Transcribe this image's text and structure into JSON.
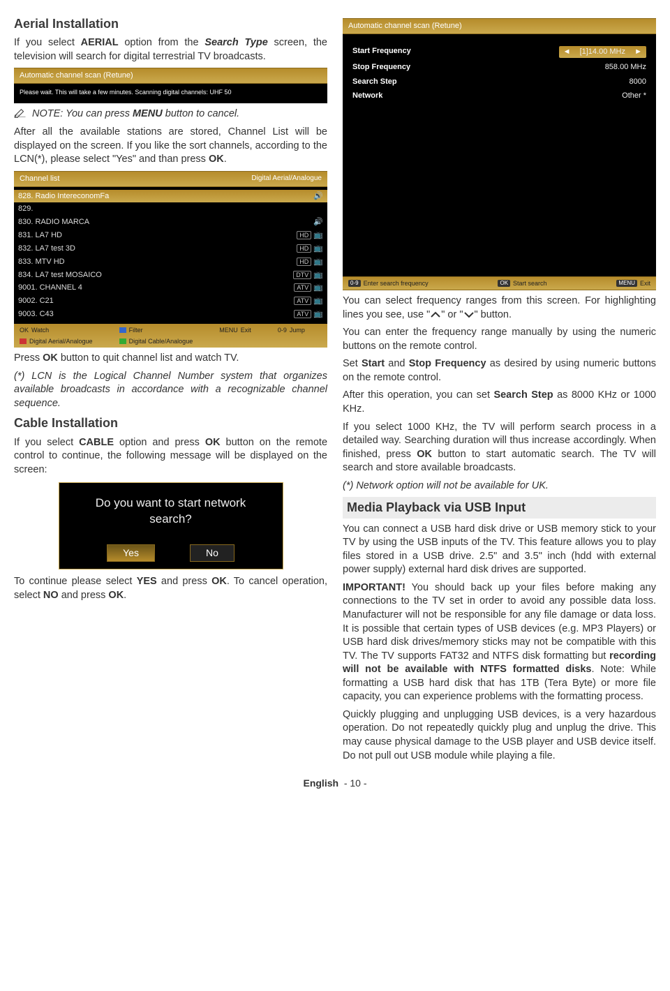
{
  "left": {
    "h_aerial": "Aerial Installation",
    "p_aerial_intro_a": "If you select ",
    "p_aerial_intro_b": "AERIAL",
    "p_aerial_intro_c": " option from the ",
    "p_aerial_intro_d": "Search Type",
    "p_aerial_intro_e": " screen, the television will search for digital terrestrial TV broadcasts.",
    "retune_shot": {
      "title": "Automatic channel scan (Retune)",
      "msg": "Please wait. This will take a few minutes. Scanning digital channels: UHF 50"
    },
    "note_a": "NOTE: You can press ",
    "note_b": "MENU",
    "note_c": " button to cancel.",
    "p_after_a": "After all the available stations are stored, Channel List will be displayed on the screen. If you like the sort channels, according to the LCN(*), please select \"Yes\" and than press ",
    "p_after_b": "OK",
    "p_after_c": ".",
    "chlist": {
      "title_l": "Channel list",
      "title_r": "Digital Aerial/Analogue",
      "rows": [
        {
          "n": "828. Radio IntereconomFa",
          "tag": ""
        },
        {
          "n": "829.",
          "tag": ""
        },
        {
          "n": "830. RADIO MARCA",
          "tag": ""
        },
        {
          "n": "831. LA7 HD",
          "tag": "HD"
        },
        {
          "n": "832. LA7 test 3D",
          "tag": "HD"
        },
        {
          "n": "833. MTV HD",
          "tag": "HD"
        },
        {
          "n": "834. LA7 test MOSAICO",
          "tag": "DTV"
        },
        {
          "n": "9001. CHANNEL 4",
          "tag": "ATV"
        },
        {
          "n": "9002. C21",
          "tag": "ATV"
        },
        {
          "n": "9003. C43",
          "tag": "ATV"
        }
      ],
      "legend": {
        "watch": "Watch",
        "filter": "Filter",
        "exit": "Exit",
        "jump": "Jump",
        "daa": "Digital Aerial/Analogue",
        "dca": "Digital Cable/Analogue"
      }
    },
    "p_pressok_a": "Press ",
    "p_pressok_b": "OK",
    "p_pressok_c": " button to quit channel list and watch TV.",
    "p_lcn": "(*) LCN is the Logical Channel Number system that organizes available broadcasts in accordance with a recognizable channel sequence.",
    "h_cable": "Cable Installation",
    "p_cable_a": "If you select ",
    "p_cable_b": "CABLE",
    "p_cable_c": " option and press ",
    "p_cable_d": "OK",
    "p_cable_e": " button on the remote control to continue, the following message will be displayed on the screen:",
    "dialog": {
      "q1": "Do you want to start network",
      "q2": "search?",
      "yes": "Yes",
      "no": "No"
    },
    "p_cont_a": "To continue please select ",
    "p_cont_b": "YES",
    "p_cont_c": " and press ",
    "p_cont_d": "OK",
    "p_cont_e": ". To cancel operation, select ",
    "p_cont_f": "NO",
    "p_cont_g": " and press ",
    "p_cont_h": "OK",
    "p_cont_i": "."
  },
  "right": {
    "scan": {
      "title": "Automatic channel scan (Retune)",
      "rows": [
        {
          "l": "Start Frequency",
          "v": "[1]14.00 MHz",
          "sel": true
        },
        {
          "l": "Stop Frequency",
          "v": "858.00 MHz"
        },
        {
          "l": "Search Step",
          "v": "8000"
        },
        {
          "l": "Network",
          "v": "Other    *"
        }
      ],
      "bb": {
        "a": "Enter search frequency",
        "b": "Start search",
        "c": "Exit"
      }
    },
    "p_freq_a": "You can select frequency ranges from this screen. For highlighting lines you see, use \"",
    "p_freq_b": "\" or \"",
    "p_freq_c": "\" button.",
    "p_manual": "You can enter the frequency range manually by using the numeric buttons on the remote control.",
    "p_set_a": "Set ",
    "p_set_b": "Start",
    "p_set_c": " and ",
    "p_set_d": "Stop Frequency",
    "p_set_e": " as desired by using numeric buttons on the remote control.",
    "p_step_a": "After this operation, you can set ",
    "p_step_b": "Search Step",
    "p_step_c": " as 8000 KHz or 1000 KHz.",
    "p_1000_a": "If you select 1000 KHz, the TV will perform search process in a detailed way. Searching duration will thus increase accordingly. When finished, press ",
    "p_1000_b": "OK",
    "p_1000_c": " button to start automatic search. The TV will search and store available broadcasts.",
    "p_net": "(*) Network option will not be available for UK.",
    "h_media": "Media Playback via USB Input",
    "p_usb1": "You can connect a USB hard disk drive or USB memory stick to your TV by using the USB inputs of the TV. This feature allows you to play files stored in a USB drive. 2.5\" and 3.5\" inch (hdd with external power supply) external hard disk drives are supported.",
    "p_usb2_a": "IMPORTANT!",
    "p_usb2_b": " You should back up your files before making any connections to the TV set in order to avoid any possible data loss. Manufacturer will not be responsible for any file damage or data loss. It is possible that certain types of USB devices (e.g. MP3 Players) or USB hard disk drives/memory sticks may not be compatible with this TV. The TV supports FAT32 and NTFS disk formatting but ",
    "p_usb2_c": "recording will not be available with NTFS formatted disks",
    "p_usb2_d": ". Note: While formatting a USB hard disk that has 1TB (Tera Byte) or more file capacity, you can experience problems with the formatting process.",
    "p_usb3": "Quickly plugging and unplugging USB devices, is a very hazardous operation. Do not repeatedly quickly plug and unplug the drive. This may cause physical damage to the USB player and USB device itself. Do not pull out USB module while playing a file."
  },
  "footer": {
    "lang": "English",
    "page": "- 10 -"
  }
}
